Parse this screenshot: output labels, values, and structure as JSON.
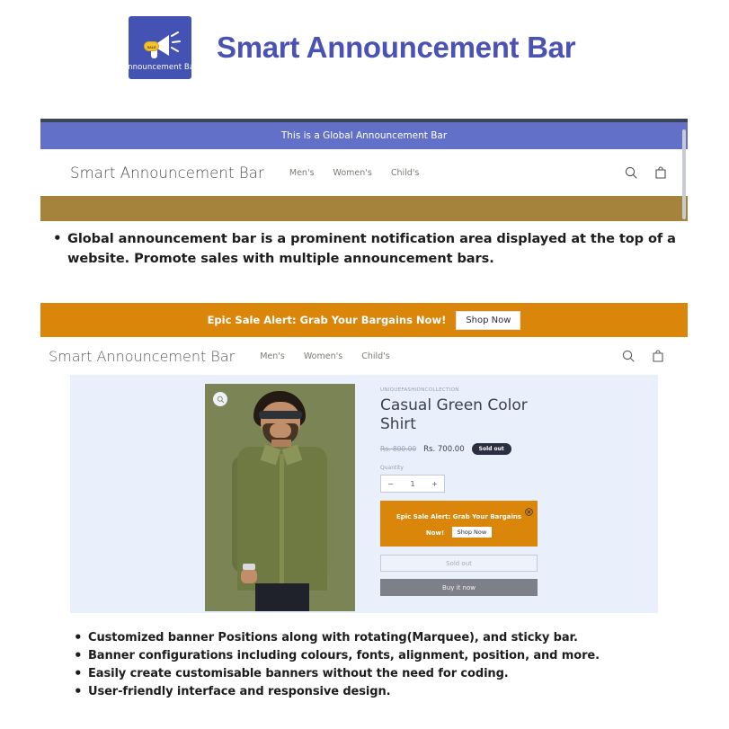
{
  "header": {
    "title": "Smart Announcement Bar",
    "logo": {
      "caption": "Announcement Bar",
      "badge": "SALE",
      "icon": "megaphone-icon"
    }
  },
  "demo_global": {
    "announcement_text": "This is a Global Announcement Bar",
    "nav": {
      "logo": "Smart Announcement Bar",
      "links": [
        "Men's",
        "Women's",
        "Child's"
      ],
      "icons": [
        "search-icon",
        "cart-icon"
      ]
    }
  },
  "features_top": [
    "Global announcement bar is a prominent notification area displayed at the top of a website. Promote sales with multiple announcement bars."
  ],
  "demo_product": {
    "promo": {
      "text": "Epic Sale Alert: Grab Your Bargains Now!",
      "button": "Shop Now"
    },
    "nav": {
      "logo": "Smart Announcement Bar",
      "links": [
        "Men's",
        "Women's",
        "Child's"
      ],
      "icons": [
        "search-icon",
        "cart-icon"
      ]
    },
    "product": {
      "vendor": "UNIQUEFASHIONCOLLECTION",
      "title": "Casual Green Color Shirt",
      "price_old": "Rs. 800.00",
      "price_new": "Rs. 700.00",
      "badge": "Sold out",
      "quantity_label": "Quantity",
      "quantity_minus": "−",
      "quantity_value": "1",
      "quantity_plus": "+",
      "inline_promo_text": "Epic Sale Alert: Grab Your Bargains Now!",
      "inline_promo_button": "Shop Now",
      "add_to_cart": "Sold out",
      "buy_now": "Buy it now",
      "zoom_icon": "zoom-in-icon",
      "close_icon": "close-icon"
    }
  },
  "features_bottom": [
    "Customized banner Positions along with rotating(Marquee), and sticky bar.",
    "Banner configurations including colours, fonts, alignment, position, and more.",
    "Easily create customisable banners without the need for coding.",
    "User-friendly interface and responsive design."
  ],
  "colors": {
    "title": "#4a52b5",
    "global_bar": "#6370c8",
    "gold_bar": "#a6833c",
    "promo_orange": "#d9860b",
    "logo_tile": "#4352b3"
  }
}
